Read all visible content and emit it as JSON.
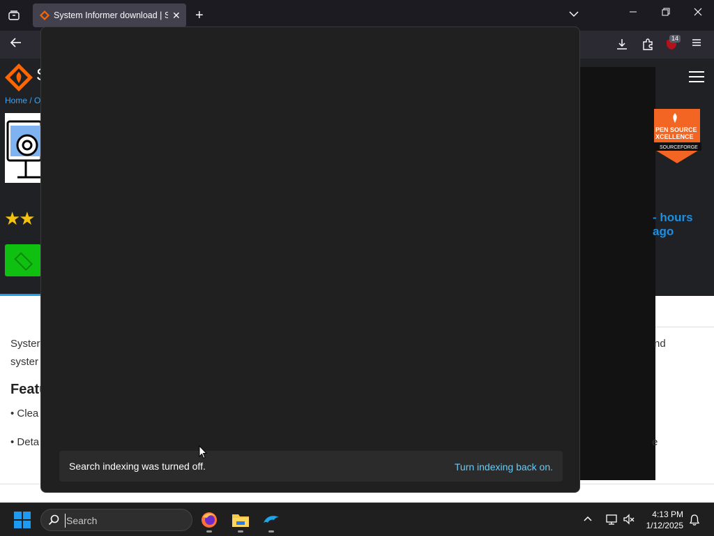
{
  "browser": {
    "tab_title": "System Informer download | Sc",
    "new_tab_symbol": "+",
    "downloads_badge": "14"
  },
  "website": {
    "site_name_initial": "S",
    "breadcrumb": "Home / O",
    "hours_ago": "- hours ago",
    "content_line1_left": "Syster",
    "content_line1_right": "nd",
    "content_line2_left": "syster",
    "feature_heading": "Featu",
    "bullet1": "• Clea",
    "bullet2": "• Deta",
    "bullet2_right": "e",
    "badge_lines": [
      "OPEN SOURCE",
      "EXCELLENCE",
      "SOURCEFORGE"
    ]
  },
  "search_flyout": {
    "indexing_message": "Search indexing was turned off.",
    "indexing_link": "Turn indexing back on."
  },
  "taskbar": {
    "search_placeholder": "Search",
    "time": "4:13 PM",
    "date": "1/12/2025"
  }
}
